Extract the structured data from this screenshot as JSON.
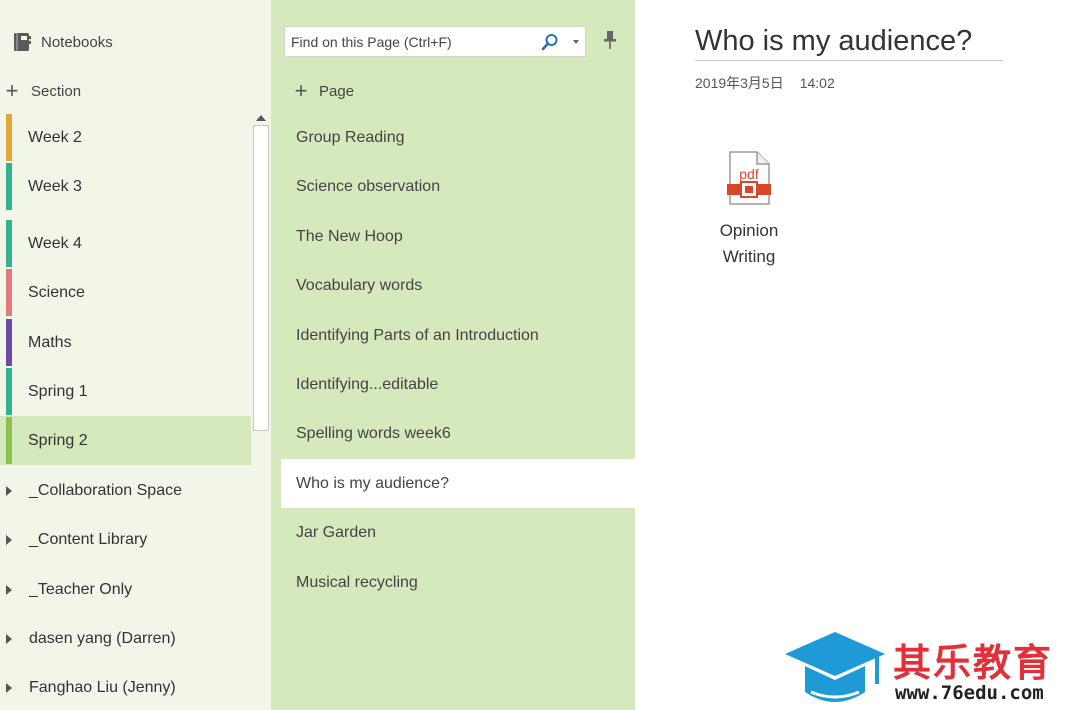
{
  "sections_pane": {
    "notebooks_label": "Notebooks",
    "add_section_label": "Section",
    "sections": [
      {
        "label": "Week 2",
        "color": "#e3a83b"
      },
      {
        "label": "Week 3",
        "color": "#34b28f"
      },
      {
        "label": "Week 4",
        "color": "#34b28f"
      },
      {
        "label": "Science",
        "color": "#e07b7b"
      },
      {
        "label": "Maths",
        "color": "#6a4aa5"
      },
      {
        "label": "Spring 1",
        "color": "#34b28f"
      },
      {
        "label": "Spring 2",
        "color": "#8cc152",
        "selected": true
      }
    ],
    "groups": [
      {
        "label": "_Collaboration Space"
      },
      {
        "label": "_Content Library"
      },
      {
        "label": "_Teacher Only"
      },
      {
        "label": "dasen yang (Darren)"
      },
      {
        "label": "Fanghao Liu (Jenny)"
      }
    ]
  },
  "pages_pane": {
    "search_placeholder": "Find on this Page (Ctrl+F)",
    "add_page_label": "Page",
    "pages": [
      {
        "label": "Group Reading"
      },
      {
        "label": "Science observation"
      },
      {
        "label": "The New Hoop"
      },
      {
        "label": "Vocabulary words"
      },
      {
        "label": "Identifying Parts of an Introduction"
      },
      {
        "label": "Identifying...editable"
      },
      {
        "label": "Spelling words week6"
      },
      {
        "label": "Who is my audience?",
        "selected": true
      },
      {
        "label": "Jar Garden"
      },
      {
        "label": "Musical recycling"
      }
    ]
  },
  "page": {
    "title": "Who is my audience?",
    "date": "2019年3月5日",
    "time": "14:02",
    "attachment": {
      "icon": "pdf-file-icon",
      "icon_text": "pdf",
      "name_line1": "Opinion",
      "name_line2": "Writing"
    }
  },
  "watermark": {
    "text": "其乐教育",
    "url": "www.76edu.com"
  },
  "colors": {
    "sections_bg": "#f2f6e8",
    "pages_bg": "#d6e9bd",
    "accent_red": "#e2303a",
    "logo_blue": "#1e9ad6"
  }
}
